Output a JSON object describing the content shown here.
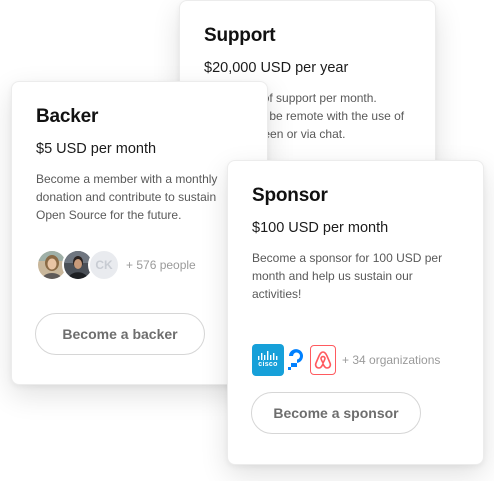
{
  "support": {
    "title": "Support",
    "price": "$20,000 USD per year",
    "description": "Up to 2hrs of support per month. Support will be remote with the use of a share screen or via chat."
  },
  "backer": {
    "title": "Backer",
    "price": "$5 USD per month",
    "description": "Become a member with a monthly donation and contribute to sustain Open Source for the future.",
    "avatars": [
      {
        "name": "avatar-woman"
      },
      {
        "name": "avatar-man"
      },
      {
        "name": "avatar-initials",
        "initials": "CK"
      }
    ],
    "count_text": "+ 576 people",
    "button_label": "Become a backer"
  },
  "sponsor": {
    "title": "Sponsor",
    "price": "$100 USD per month",
    "description": "Become a sponsor for 100 USD per month and help us sustain our activities!",
    "organizations": [
      {
        "icon": "cisco-logo-icon",
        "label": "cisco"
      },
      {
        "icon": "digitalocean-logo-icon"
      },
      {
        "icon": "airbnb-logo-icon"
      }
    ],
    "count_text": "+ 34 organizations",
    "button_label": "Become a sponsor"
  },
  "colors": {
    "cisco": "#16a0d9",
    "digitalocean": "#0080ff",
    "airbnb": "#ff5a5f"
  }
}
